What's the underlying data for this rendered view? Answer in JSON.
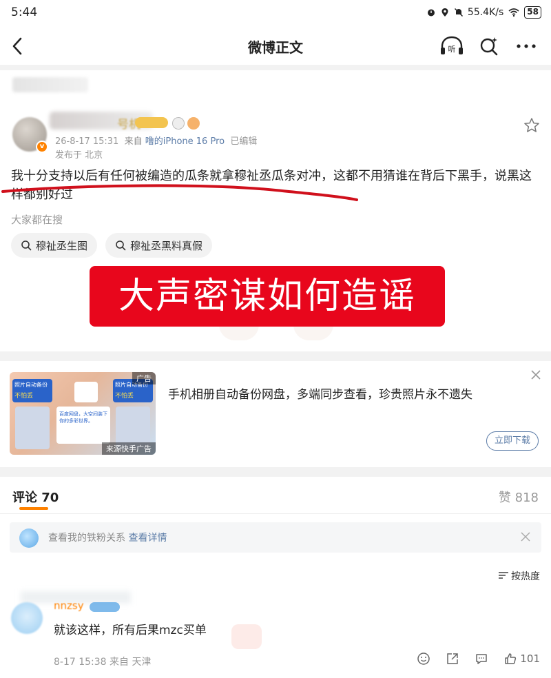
{
  "status_bar": {
    "time": "5:44",
    "network_speed": "55.4K/s",
    "battery": "58"
  },
  "nav": {
    "title": "微博正文",
    "listen_label": "听"
  },
  "post": {
    "meta_time": "26-8-17 15:31",
    "meta_source": "来自",
    "meta_device": "噜的iPhone 16 Pro",
    "meta_edited": "已编辑",
    "location": "发布于 北京",
    "name_fragment": "号机",
    "text": "我十分支持以后有任何被编造的瓜条就拿穆祉丞瓜条对冲，这都不用猜谁在背后下黑手，说黑这样都别好过",
    "search_label": "大家都在搜",
    "chips": [
      "穆祉丞生图",
      "穆祉丞黑料真假"
    ],
    "banner_text": "大声密谋如何造谣"
  },
  "ad": {
    "tag": "广告",
    "source": "来源快手广告",
    "text": "手机相册自动备份网盘，多端同步查看，珍贵照片永不遗失",
    "download_label": "立即下载",
    "img_text_1": "照片自动备份",
    "img_text_2": "不怕丢",
    "img_text_3": "百度网盘，大空间装下你的多彩世界。"
  },
  "comments": {
    "tab_label": "评论 70",
    "likes_label": "赞 818",
    "fan_text": "查看我的铁粉关系",
    "fan_link": "查看详情",
    "sort_label": "按热度",
    "items": [
      {
        "name": "nnzsy",
        "text": "就该这样，所有后果mzc买单",
        "meta": "8-17 15:38 来自 天津",
        "like_count": "101"
      }
    ]
  },
  "colors": {
    "accent": "#ff8200",
    "link": "#5d7da8",
    "banner_red": "#e8061c"
  }
}
